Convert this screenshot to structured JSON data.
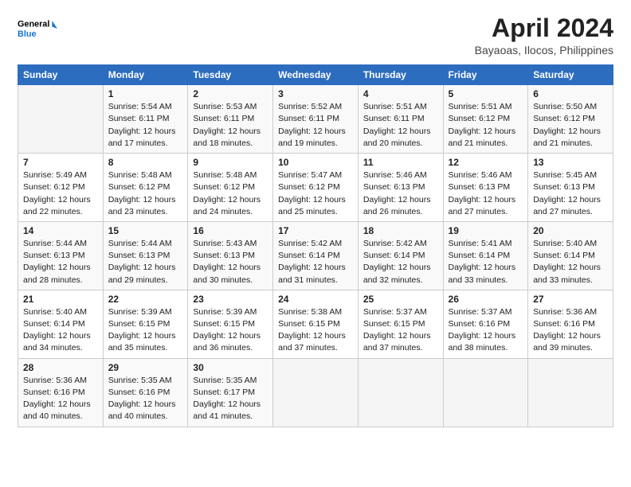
{
  "logo": {
    "line1": "General",
    "line2": "Blue"
  },
  "title": "April 2024",
  "subtitle": "Bayaoas, Ilocos, Philippines",
  "days_of_week": [
    "Sunday",
    "Monday",
    "Tuesday",
    "Wednesday",
    "Thursday",
    "Friday",
    "Saturday"
  ],
  "weeks": [
    [
      {
        "day": "",
        "info": ""
      },
      {
        "day": "1",
        "info": "Sunrise: 5:54 AM\nSunset: 6:11 PM\nDaylight: 12 hours\nand 17 minutes."
      },
      {
        "day": "2",
        "info": "Sunrise: 5:53 AM\nSunset: 6:11 PM\nDaylight: 12 hours\nand 18 minutes."
      },
      {
        "day": "3",
        "info": "Sunrise: 5:52 AM\nSunset: 6:11 PM\nDaylight: 12 hours\nand 19 minutes."
      },
      {
        "day": "4",
        "info": "Sunrise: 5:51 AM\nSunset: 6:11 PM\nDaylight: 12 hours\nand 20 minutes."
      },
      {
        "day": "5",
        "info": "Sunrise: 5:51 AM\nSunset: 6:12 PM\nDaylight: 12 hours\nand 21 minutes."
      },
      {
        "day": "6",
        "info": "Sunrise: 5:50 AM\nSunset: 6:12 PM\nDaylight: 12 hours\nand 21 minutes."
      }
    ],
    [
      {
        "day": "7",
        "info": "Sunrise: 5:49 AM\nSunset: 6:12 PM\nDaylight: 12 hours\nand 22 minutes."
      },
      {
        "day": "8",
        "info": "Sunrise: 5:48 AM\nSunset: 6:12 PM\nDaylight: 12 hours\nand 23 minutes."
      },
      {
        "day": "9",
        "info": "Sunrise: 5:48 AM\nSunset: 6:12 PM\nDaylight: 12 hours\nand 24 minutes."
      },
      {
        "day": "10",
        "info": "Sunrise: 5:47 AM\nSunset: 6:12 PM\nDaylight: 12 hours\nand 25 minutes."
      },
      {
        "day": "11",
        "info": "Sunrise: 5:46 AM\nSunset: 6:13 PM\nDaylight: 12 hours\nand 26 minutes."
      },
      {
        "day": "12",
        "info": "Sunrise: 5:46 AM\nSunset: 6:13 PM\nDaylight: 12 hours\nand 27 minutes."
      },
      {
        "day": "13",
        "info": "Sunrise: 5:45 AM\nSunset: 6:13 PM\nDaylight: 12 hours\nand 27 minutes."
      }
    ],
    [
      {
        "day": "14",
        "info": "Sunrise: 5:44 AM\nSunset: 6:13 PM\nDaylight: 12 hours\nand 28 minutes."
      },
      {
        "day": "15",
        "info": "Sunrise: 5:44 AM\nSunset: 6:13 PM\nDaylight: 12 hours\nand 29 minutes."
      },
      {
        "day": "16",
        "info": "Sunrise: 5:43 AM\nSunset: 6:13 PM\nDaylight: 12 hours\nand 30 minutes."
      },
      {
        "day": "17",
        "info": "Sunrise: 5:42 AM\nSunset: 6:14 PM\nDaylight: 12 hours\nand 31 minutes."
      },
      {
        "day": "18",
        "info": "Sunrise: 5:42 AM\nSunset: 6:14 PM\nDaylight: 12 hours\nand 32 minutes."
      },
      {
        "day": "19",
        "info": "Sunrise: 5:41 AM\nSunset: 6:14 PM\nDaylight: 12 hours\nand 33 minutes."
      },
      {
        "day": "20",
        "info": "Sunrise: 5:40 AM\nSunset: 6:14 PM\nDaylight: 12 hours\nand 33 minutes."
      }
    ],
    [
      {
        "day": "21",
        "info": "Sunrise: 5:40 AM\nSunset: 6:14 PM\nDaylight: 12 hours\nand 34 minutes."
      },
      {
        "day": "22",
        "info": "Sunrise: 5:39 AM\nSunset: 6:15 PM\nDaylight: 12 hours\nand 35 minutes."
      },
      {
        "day": "23",
        "info": "Sunrise: 5:39 AM\nSunset: 6:15 PM\nDaylight: 12 hours\nand 36 minutes."
      },
      {
        "day": "24",
        "info": "Sunrise: 5:38 AM\nSunset: 6:15 PM\nDaylight: 12 hours\nand 37 minutes."
      },
      {
        "day": "25",
        "info": "Sunrise: 5:37 AM\nSunset: 6:15 PM\nDaylight: 12 hours\nand 37 minutes."
      },
      {
        "day": "26",
        "info": "Sunrise: 5:37 AM\nSunset: 6:16 PM\nDaylight: 12 hours\nand 38 minutes."
      },
      {
        "day": "27",
        "info": "Sunrise: 5:36 AM\nSunset: 6:16 PM\nDaylight: 12 hours\nand 39 minutes."
      }
    ],
    [
      {
        "day": "28",
        "info": "Sunrise: 5:36 AM\nSunset: 6:16 PM\nDaylight: 12 hours\nand 40 minutes."
      },
      {
        "day": "29",
        "info": "Sunrise: 5:35 AM\nSunset: 6:16 PM\nDaylight: 12 hours\nand 40 minutes."
      },
      {
        "day": "30",
        "info": "Sunrise: 5:35 AM\nSunset: 6:17 PM\nDaylight: 12 hours\nand 41 minutes."
      },
      {
        "day": "",
        "info": ""
      },
      {
        "day": "",
        "info": ""
      },
      {
        "day": "",
        "info": ""
      },
      {
        "day": "",
        "info": ""
      }
    ]
  ]
}
